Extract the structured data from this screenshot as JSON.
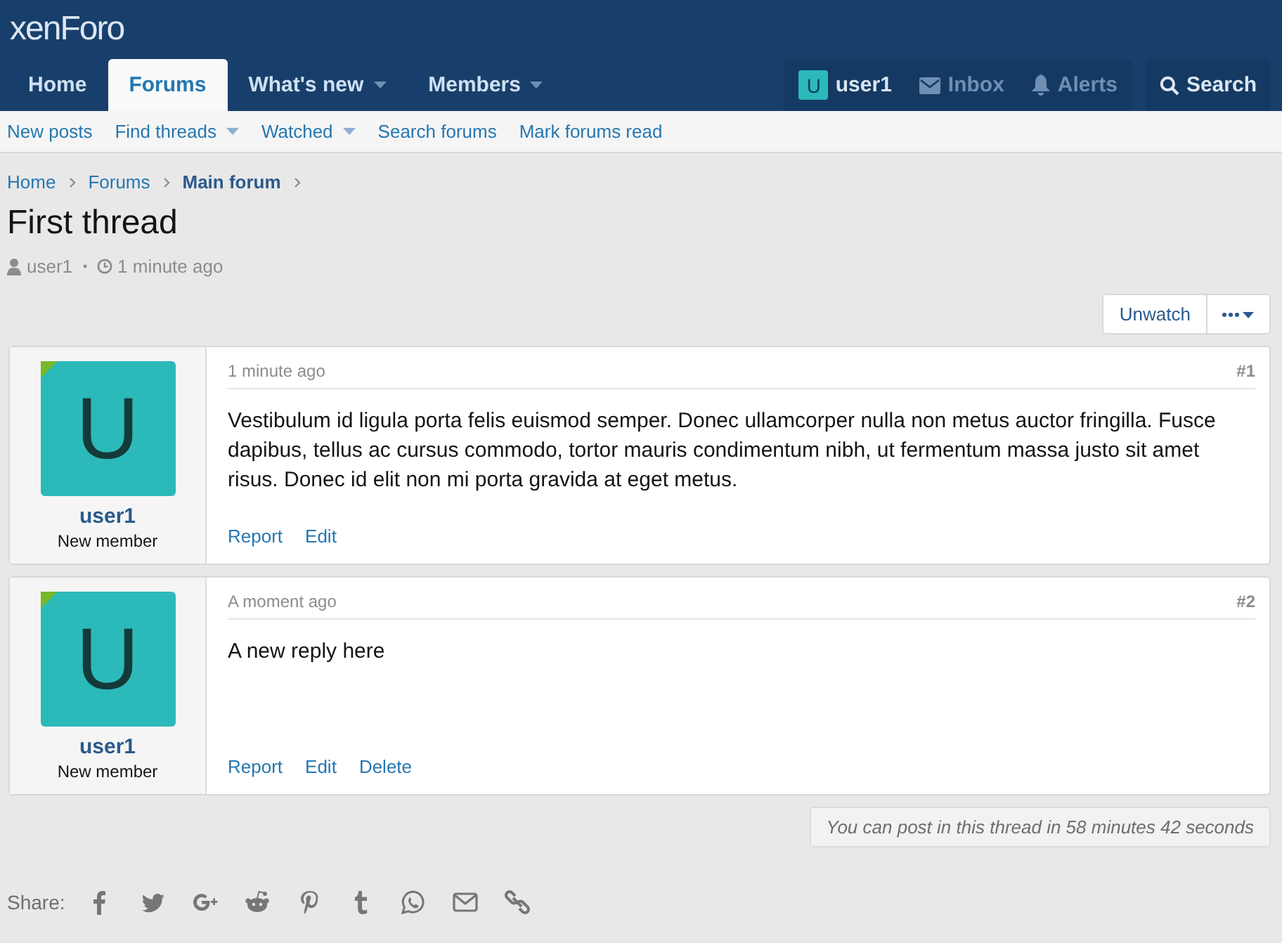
{
  "logo": {
    "text": "xenForo"
  },
  "nav": {
    "tabs": [
      {
        "label": "Home",
        "selected": false,
        "dropdown": false
      },
      {
        "label": "Forums",
        "selected": true,
        "dropdown": false
      },
      {
        "label": "What's new",
        "selected": false,
        "dropdown": true
      },
      {
        "label": "Members",
        "selected": false,
        "dropdown": true
      }
    ],
    "account": {
      "avatar_letter": "U",
      "name": "user1"
    },
    "inbox": "Inbox",
    "alerts": "Alerts",
    "search": "Search"
  },
  "subnav": [
    {
      "label": "New posts",
      "dropdown": false
    },
    {
      "label": "Find threads",
      "dropdown": true
    },
    {
      "label": "Watched",
      "dropdown": true
    },
    {
      "label": "Search forums",
      "dropdown": false
    },
    {
      "label": "Mark forums read",
      "dropdown": false
    }
  ],
  "breadcrumbs": [
    {
      "label": "Home",
      "current": false
    },
    {
      "label": "Forums",
      "current": false
    },
    {
      "label": "Main forum",
      "current": true
    }
  ],
  "thread": {
    "title": "First thread",
    "author": "user1",
    "time": "1 minute ago"
  },
  "actions": {
    "unwatch": "Unwatch"
  },
  "posts": [
    {
      "avatar_letter": "U",
      "username": "user1",
      "user_title": "New member",
      "time": "1 minute ago",
      "number": "#1",
      "body": "Vestibulum id ligula porta felis euismod semper. Donec ullamcorper nulla non metus auctor fringilla. Fusce dapibus, tellus ac cursus commodo, tortor mauris condimentum nibh, ut fermentum massa justo sit amet risus. Donec id elit non mi porta gravida at eget metus.",
      "actions": [
        "Report",
        "Edit"
      ]
    },
    {
      "avatar_letter": "U",
      "username": "user1",
      "user_title": "New member",
      "time": "A moment ago",
      "number": "#2",
      "body": "A new reply here",
      "actions": [
        "Report",
        "Edit",
        "Delete"
      ]
    }
  ],
  "notice": "You can post in this thread in 58 minutes 42 seconds",
  "share": {
    "label": "Share:"
  }
}
